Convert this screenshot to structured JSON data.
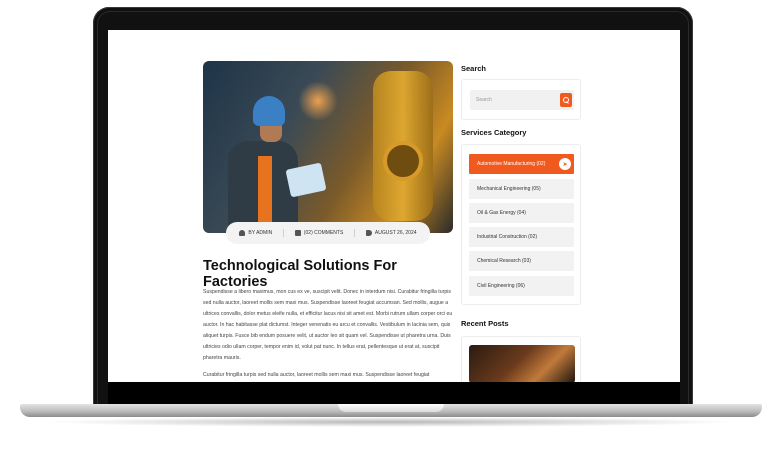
{
  "post": {
    "meta": {
      "author": "BY ADMIN",
      "comments": "(02) COMMENTS",
      "date": "AUGUST 26, 2024"
    },
    "title": "Technological Solutions For Factories",
    "paragraph1": "Suspendisse a libero maximus, mon cus ex ve, suscipit velit. Donec in interdum nisi. Curabitur fringilla turpis sed nulla auctor, laoreet mollis sem maxi mus. Suspendisse laoreet feugiat accumsan. Sed mollis, augue a ultrices convallis, dolor metus eleife nulla, et efficitur lacus nisi sit amet est. Morbi rutrum ullam corper orci eu auctor. In hac habitasse plat dictumst. Integer venenatis eu arcu et convallis. Vestibulum in lacinia sem, quis aliquet turpis. Fusce bib endum posuere velit, ut auctor leo sit quam vel. Suspendisse ut pharetra urna. Duis ultricies odio ullam corper, tempor enim id, volut pat nunc. In tellus erat, pellentesque ut erat at, suscipit pharetra mauris.",
    "paragraph2": "Curabitur fringilla turpis sed nulla auctor, laoreet mollis sem maxi mus. Suspendisse laoreet feugiat"
  },
  "sidebar": {
    "search": {
      "title": "Search",
      "placeholder": "Search"
    },
    "categories": {
      "title": "Services Category",
      "items": [
        {
          "label": "Automotive Manufacturing  (02)",
          "active": true
        },
        {
          "label": "Mechanical Engineering  (05)",
          "active": false
        },
        {
          "label": "Oil & Gas Energy  (04)",
          "active": false
        },
        {
          "label": "Industrial Construction  (02)",
          "active": false
        },
        {
          "label": "Chemical Research  (03)",
          "active": false
        },
        {
          "label": "Civil Engineering  (06)",
          "active": false
        }
      ]
    },
    "recent": {
      "title": "Recent Posts"
    }
  },
  "colors": {
    "accent": "#f15a1f"
  }
}
